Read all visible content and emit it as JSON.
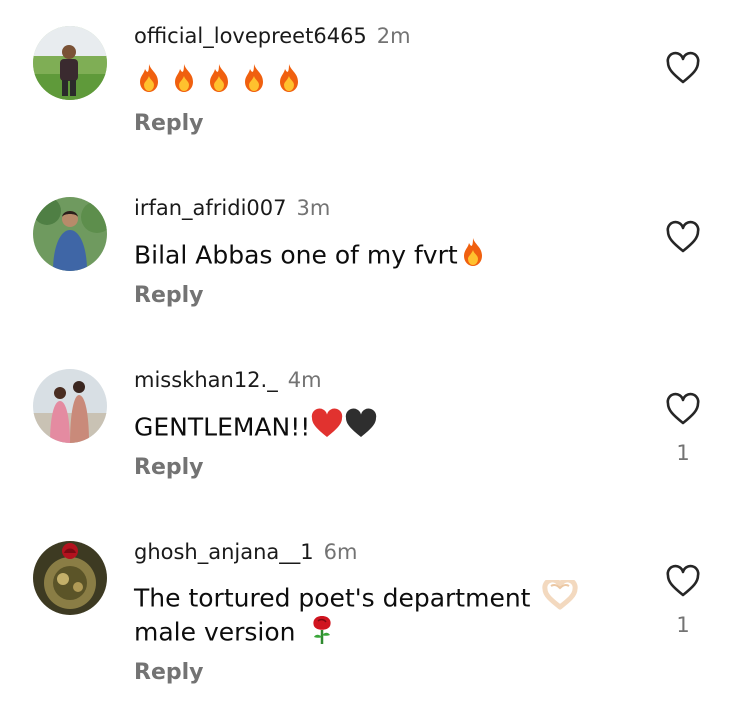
{
  "comments": [
    {
      "username": "official_lovepreet6465",
      "time": "2m",
      "text": "",
      "text_line2": "",
      "reply_label": "Reply",
      "like_count": "",
      "emojis": [
        "fire",
        "fire",
        "fire",
        "fire",
        "fire"
      ]
    },
    {
      "username": "irfan_afridi007",
      "time": "3m",
      "text": "Bilal Abbas one of my fvrt",
      "text_line2": "",
      "reply_label": "Reply",
      "like_count": "",
      "emojis": [
        "fire"
      ]
    },
    {
      "username": "misskhan12._",
      "time": "4m",
      "text": "GENTLEMAN!!",
      "text_line2": "",
      "reply_label": "Reply",
      "like_count": "1",
      "emojis": [
        "red-heart",
        "black-heart"
      ]
    },
    {
      "username": "ghosh_anjana__1",
      "time": "6m",
      "text": "The tortured poet's department",
      "text_line2": "male version",
      "reply_label": "Reply",
      "like_count": "1",
      "emojis": [
        "heart-hands",
        "rose"
      ]
    }
  ],
  "colors": {
    "secondary_text": "#737373",
    "primary_text": "#111111",
    "background": "#ffffff"
  }
}
